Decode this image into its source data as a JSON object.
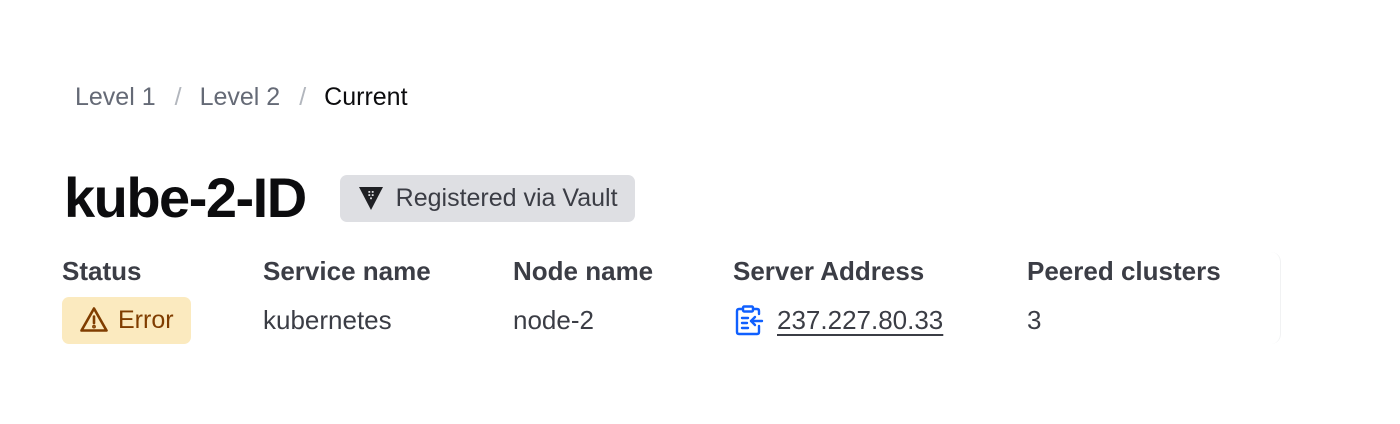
{
  "breadcrumb": {
    "items": [
      {
        "label": "Level 1"
      },
      {
        "label": "Level 2"
      }
    ],
    "separator": "/",
    "current": "Current"
  },
  "header": {
    "title": "kube-2-ID",
    "badge": {
      "label": "Registered via Vault",
      "icon": "vault-icon"
    }
  },
  "details": {
    "status": {
      "label": "Status",
      "value": "Error",
      "icon": "alert-triangle-icon",
      "color": "#803d00",
      "background": "#fbeabf"
    },
    "service_name": {
      "label": "Service name",
      "value": "kubernetes"
    },
    "node_name": {
      "label": "Node name",
      "value": "node-2"
    },
    "server_address": {
      "label": "Server Address",
      "value": "237.227.80.33",
      "icon": "clipboard-copy-icon",
      "icon_color": "#1060ff"
    },
    "peered_clusters": {
      "label": "Peered clusters",
      "value": "3"
    }
  }
}
